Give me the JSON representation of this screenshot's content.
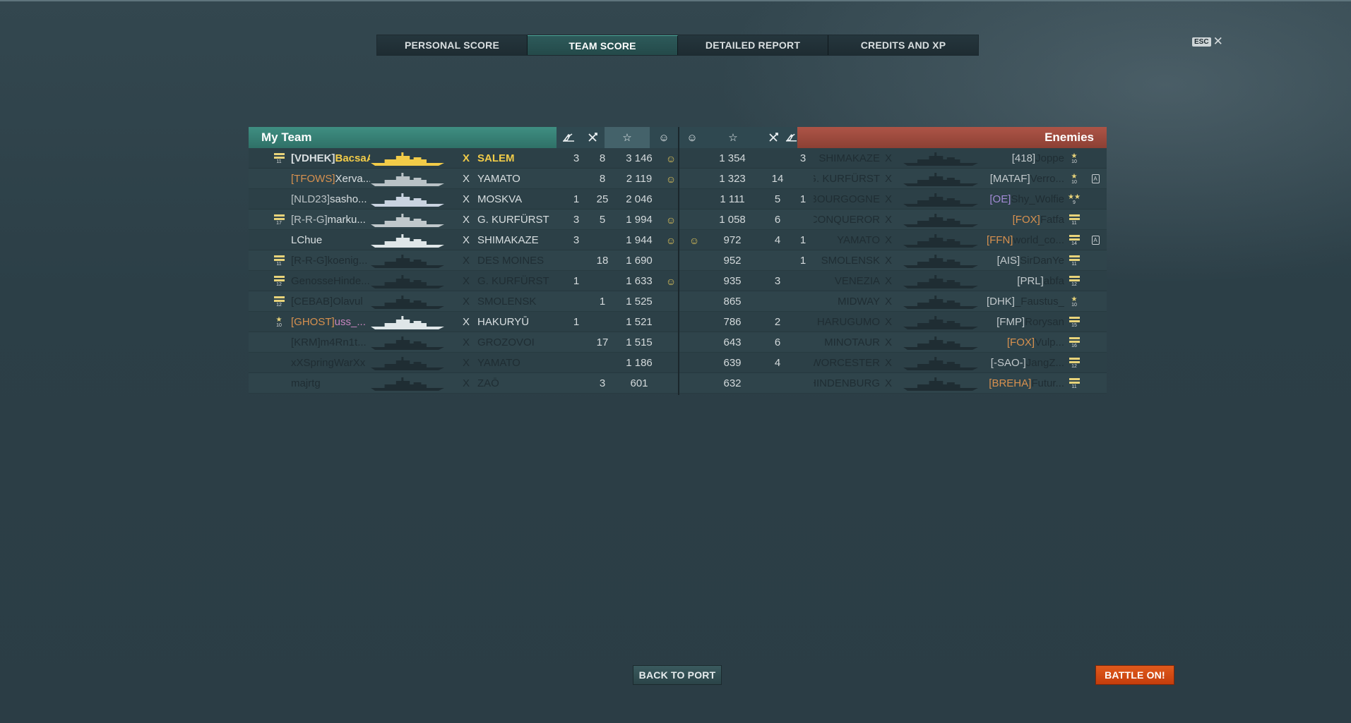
{
  "tabs": [
    {
      "label": "PERSONAL SCORE"
    },
    {
      "label": "TEAM SCORE"
    },
    {
      "label": "DETAILED REPORT"
    },
    {
      "label": "CREDITS AND XP"
    }
  ],
  "esc": {
    "key": "ESC",
    "close": "✕"
  },
  "my_team": {
    "title": "My Team",
    "columns": [
      "plane",
      "ship-kill",
      "star",
      "ribbon"
    ],
    "rows": [
      {
        "rank": "11",
        "clan": "[VDHEK]",
        "name": "BacsaA",
        "x": "X",
        "ship": "SALEM",
        "planes": "3",
        "kills": "8",
        "score": "3 146",
        "ribbon": "☺"
      },
      {
        "rank": "",
        "clan": "[TFOWS]",
        "name": "Xerva...",
        "x": "X",
        "ship": "YAMATO",
        "planes": "",
        "kills": "8",
        "score": "2 119",
        "ribbon": "☺"
      },
      {
        "rank": "",
        "clan": "[NLD23]",
        "name": "sasho...",
        "x": "X",
        "ship": "MOSKVA",
        "planes": "1",
        "kills": "25",
        "score": "2 046",
        "ribbon": ""
      },
      {
        "rank": "17",
        "clan": "[R-R-G]",
        "name": "marku...",
        "x": "X",
        "ship": "G. KURFÜRST",
        "planes": "3",
        "kills": "5",
        "score": "1 994",
        "ribbon": "☺"
      },
      {
        "rank": "",
        "clan": "",
        "name": "LChue",
        "x": "X",
        "ship": "SHIMAKAZE",
        "planes": "3",
        "kills": "",
        "score": "1 944",
        "ribbon": "☺"
      },
      {
        "rank": "11",
        "clan": "[R-R-G]",
        "name": "koenig...",
        "x": "X",
        "ship": "DES MOINES",
        "planes": "",
        "kills": "18",
        "score": "1 690",
        "ribbon": ""
      },
      {
        "rank": "12",
        "clan": "",
        "name": "GenosseHinde...",
        "x": "X",
        "ship": "G. KURFÜRST",
        "planes": "1",
        "kills": "",
        "score": "1 633",
        "ribbon": "☺"
      },
      {
        "rank": "12",
        "clan": "[CEBAB]",
        "name": "Olavul",
        "x": "X",
        "ship": "SMOLENSK",
        "planes": "",
        "kills": "1",
        "score": "1 525",
        "ribbon": ""
      },
      {
        "rank": "10",
        "clan": "[GHOST]",
        "name": "uss_...",
        "x": "X",
        "ship": "HAKURYŪ",
        "planes": "1",
        "kills": "",
        "score": "1 521",
        "ribbon": ""
      },
      {
        "rank": "",
        "clan": "[KRM]",
        "name": "m4Rn1t...",
        "x": "X",
        "ship": "GROZOVOI",
        "planes": "",
        "kills": "17",
        "score": "1 515",
        "ribbon": ""
      },
      {
        "rank": "",
        "clan": "",
        "name": "xXSpringWarXx",
        "x": "X",
        "ship": "YAMATO",
        "planes": "",
        "kills": "",
        "score": "1 186",
        "ribbon": ""
      },
      {
        "rank": "",
        "clan": "",
        "name": "majrtg",
        "x": "X",
        "ship": "ZAŌ",
        "planes": "",
        "kills": "3",
        "score": "601",
        "ribbon": ""
      }
    ]
  },
  "enemies": {
    "title": "Enemies",
    "rows": [
      {
        "ribbon": "",
        "score": "1 354",
        "kills": "",
        "planes": "3",
        "ship": "SHIMAKAZE",
        "x": "X",
        "clan": "[418]",
        "name": "Joppe",
        "rank": "10",
        "badge": ""
      },
      {
        "ribbon": "",
        "score": "1 323",
        "kills": "14",
        "planes": "",
        "ship": "G. KURFÜRST",
        "x": "X",
        "clan": "[MATAF]",
        "name": "Verro...",
        "rank": "10",
        "badge": "A"
      },
      {
        "ribbon": "",
        "score": "1 111",
        "kills": "5",
        "planes": "1",
        "ship": "BOURGOGNE",
        "x": "X",
        "clan": "[OE]",
        "name": "Shy_Wolfie",
        "rank": "9",
        "badge": ""
      },
      {
        "ribbon": "",
        "score": "1 058",
        "kills": "6",
        "planes": "",
        "ship": "CONQUEROR",
        "x": "X",
        "clan": "[FOX]",
        "name": "Fatfa",
        "rank": "11",
        "badge": ""
      },
      {
        "ribbon": "☺",
        "score": "972",
        "kills": "4",
        "planes": "1",
        "ship": "YAMATO",
        "x": "X",
        "clan": "[FFN]",
        "name": "world_co...",
        "rank": "14",
        "badge": "A"
      },
      {
        "ribbon": "",
        "score": "952",
        "kills": "",
        "planes": "1",
        "ship": "SMOLENSK",
        "x": "X",
        "clan": "[AIS]",
        "name": "SirDanYe",
        "rank": "11",
        "badge": ""
      },
      {
        "ribbon": "",
        "score": "935",
        "kills": "3",
        "planes": "",
        "ship": "VENEZIA",
        "x": "X",
        "clan": "[PRL]",
        "name": "abfa",
        "rank": "12",
        "badge": ""
      },
      {
        "ribbon": "",
        "score": "865",
        "kills": "",
        "planes": "",
        "ship": "MIDWAY",
        "x": "X",
        "clan": "[DHK]",
        "name": "_Faustus_",
        "rank": "10",
        "badge": ""
      },
      {
        "ribbon": "",
        "score": "786",
        "kills": "2",
        "planes": "",
        "ship": "HARUGUMO",
        "x": "X",
        "clan": "[FMP]",
        "name": "Rorysan",
        "rank": "15",
        "badge": ""
      },
      {
        "ribbon": "",
        "score": "643",
        "kills": "6",
        "planes": "",
        "ship": "MINOTAUR",
        "x": "X",
        "clan": "[FOX]",
        "name": "Vulp...",
        "rank": "16",
        "badge": ""
      },
      {
        "ribbon": "",
        "score": "639",
        "kills": "4",
        "planes": "",
        "ship": "WORCESTER",
        "x": "X",
        "clan": "[-SAO-]",
        "name": "JangZ...",
        "rank": "12",
        "badge": ""
      },
      {
        "ribbon": "",
        "score": "632",
        "kills": "",
        "planes": "",
        "ship": "HINDENBURG",
        "x": "X",
        "clan": "[BREHA]",
        "name": "Futur...",
        "rank": "11",
        "badge": ""
      }
    ]
  },
  "header_icons": {
    "plane": "✈",
    "kill": "✕",
    "star": "☆",
    "ribbon": "☺"
  },
  "buttons": {
    "back": "BACK TO PORT",
    "battle": "BATTLE ON!"
  }
}
